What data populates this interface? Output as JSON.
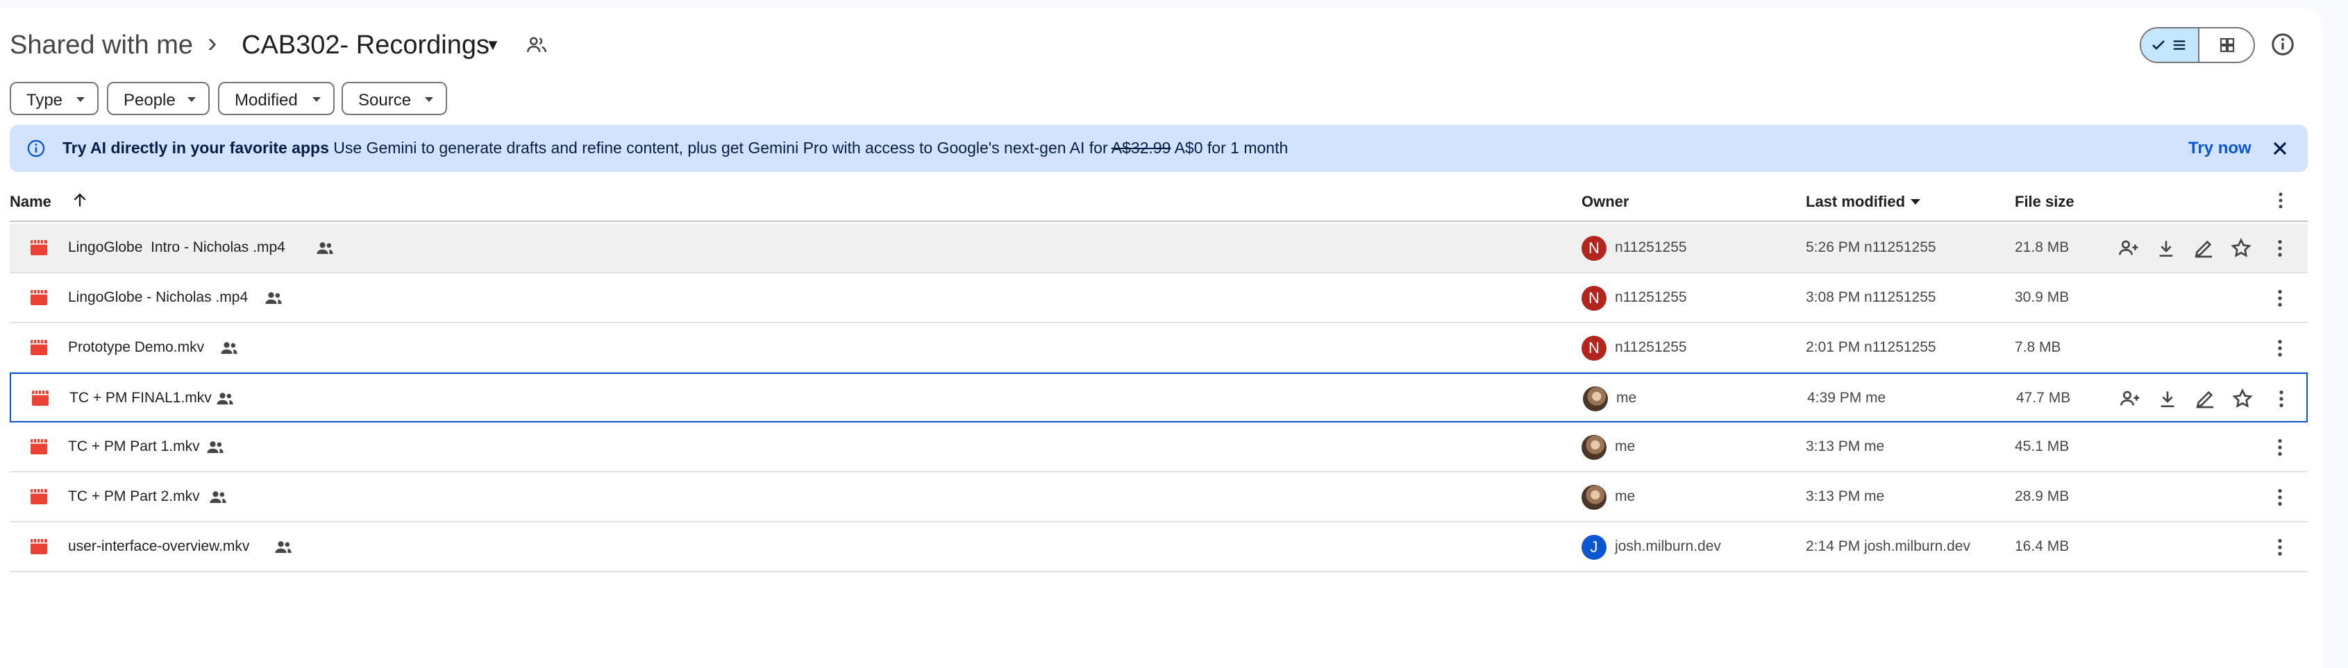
{
  "breadcrumb": {
    "root": "Shared with me",
    "separator": "›",
    "current": "CAB302- Recordings"
  },
  "filters": [
    {
      "label": "Type"
    },
    {
      "label": "People"
    },
    {
      "label": "Modified"
    },
    {
      "label": "Source"
    }
  ],
  "banner": {
    "bold": "Try AI directly in your favorite apps",
    "text": "Use Gemini to generate drafts and refine content, plus get Gemini Pro with access to Google's next-gen AI for",
    "old_price": "A$32.99",
    "new_price": "A$0 for 1 month",
    "action": "Try now"
  },
  "table": {
    "columns": {
      "name": "Name",
      "owner": "Owner",
      "modified": "Last modified",
      "size": "File size"
    },
    "rows": [
      {
        "name": "LingoGlobe  Intro - Nicholas .mp4",
        "owner": "n11251255",
        "avatar": "N",
        "avatar_color": "#b3261e",
        "modified": "5:26 PM  n11251255",
        "size": "21.8 MB"
      },
      {
        "name": "LingoGlobe - Nicholas .mp4",
        "owner": "n11251255",
        "avatar": "N",
        "avatar_color": "#b3261e",
        "modified": "3:08 PM  n11251255",
        "size": "30.9 MB"
      },
      {
        "name": "Prototype Demo.mkv",
        "owner": "n11251255",
        "avatar": "N",
        "avatar_color": "#b3261e",
        "modified": "2:01 PM  n11251255",
        "size": "7.8 MB"
      },
      {
        "name": "TC + PM FINAL1.mkv",
        "owner": "me",
        "avatar": "",
        "avatar_color": "photo",
        "modified": "4:39 PM  me",
        "size": "47.7 MB"
      },
      {
        "name": "TC + PM Part 1.mkv",
        "owner": "me",
        "avatar": "",
        "avatar_color": "photo",
        "modified": "3:13 PM  me",
        "size": "45.1 MB"
      },
      {
        "name": "TC + PM Part 2.mkv",
        "owner": "me",
        "avatar": "",
        "avatar_color": "photo",
        "modified": "3:13 PM  me",
        "size": "28.9 MB"
      },
      {
        "name": "user-interface-overview.mkv",
        "owner": "josh.milburn.dev",
        "avatar": "J",
        "avatar_color": "#0b57d0",
        "modified": "2:14 PM  josh.milburn.dev",
        "size": "16.4 MB"
      }
    ]
  },
  "colors": {
    "accent": "#0b57d0",
    "banner_bg": "#d3e3fd",
    "video_icon": "#ea4335",
    "toggle_selected": "#c2e7ff"
  },
  "icons": [
    "shared-folder-icon",
    "check-icon",
    "list-view-icon",
    "grid-view-icon",
    "info-icon",
    "video-file-icon",
    "shared-icon",
    "share-icon",
    "download-icon",
    "rename-icon",
    "star-icon",
    "more-vert-icon",
    "close-icon",
    "arrow-up-icon"
  ]
}
